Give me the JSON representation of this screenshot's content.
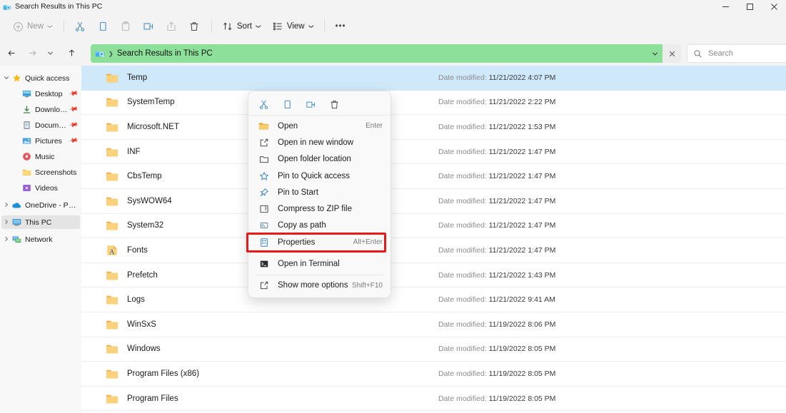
{
  "window": {
    "title": "Search Results in This PC",
    "icon": "explorer-search-icon",
    "minimize": "—",
    "maximize": "❐",
    "close": "✕"
  },
  "toolbar": {
    "new_label": "New",
    "new_icon": "plus-circle-icon",
    "cut_icon": "scissors-icon",
    "copy_icon": "copy-icon",
    "paste_icon": "paste-icon",
    "rename_icon": "rename-icon",
    "share_icon": "share-icon",
    "delete_icon": "trash-icon",
    "sort_label": "Sort",
    "sort_icon": "sort-arrows-icon",
    "view_label": "View",
    "view_icon": "view-list-icon",
    "more_label": "•••",
    "caret": "❯"
  },
  "navigation": {
    "back": "←",
    "forward": "→",
    "recent": "❯",
    "up": "↑"
  },
  "address": {
    "icon": "explorer-search-icon",
    "separator": "❯",
    "path": "Search Results in This PC",
    "dropdown": "❯",
    "clear": "✕",
    "highlight_color": "#8ce09a"
  },
  "search": {
    "placeholder": "Search",
    "value": "",
    "icon": "magnifier-icon"
  },
  "sidebar": {
    "items": [
      {
        "label": "Quick access",
        "icon": "star-icon",
        "chevron": "❯",
        "expanded": true,
        "indent": false,
        "pinned": false,
        "selected": false
      },
      {
        "label": "Desktop",
        "icon": "desktop-icon",
        "chevron": "",
        "expanded": false,
        "indent": true,
        "pinned": true,
        "selected": false
      },
      {
        "label": "Downloads",
        "icon": "downloads-icon",
        "chevron": "",
        "expanded": false,
        "indent": true,
        "pinned": true,
        "selected": false
      },
      {
        "label": "Documents",
        "icon": "documents-icon",
        "chevron": "",
        "expanded": false,
        "indent": true,
        "pinned": true,
        "selected": false
      },
      {
        "label": "Pictures",
        "icon": "pictures-icon",
        "chevron": "",
        "expanded": false,
        "indent": true,
        "pinned": true,
        "selected": false
      },
      {
        "label": "Music",
        "icon": "music-icon",
        "chevron": "",
        "expanded": false,
        "indent": true,
        "pinned": false,
        "selected": false
      },
      {
        "label": "Screenshots",
        "icon": "folder-icon",
        "chevron": "",
        "expanded": false,
        "indent": true,
        "pinned": false,
        "selected": false
      },
      {
        "label": "Videos",
        "icon": "videos-icon",
        "chevron": "",
        "expanded": false,
        "indent": true,
        "pinned": false,
        "selected": false
      },
      {
        "label": "OneDrive - Personal",
        "icon": "onedrive-cloud-icon",
        "chevron": "❯",
        "expanded": false,
        "indent": false,
        "pinned": false,
        "selected": false
      },
      {
        "label": "This PC",
        "icon": "this-pc-icon",
        "chevron": "❯",
        "expanded": false,
        "indent": false,
        "pinned": false,
        "selected": true
      },
      {
        "label": "Network",
        "icon": "network-icon",
        "chevron": "❯",
        "expanded": false,
        "indent": false,
        "pinned": false,
        "selected": false
      }
    ]
  },
  "filelist": {
    "date_label": "Date modified:",
    "rows": [
      {
        "name": "Temp",
        "icon": "folder-icon",
        "date": "11/21/2022 4:07 PM",
        "selected": true
      },
      {
        "name": "SystemTemp",
        "icon": "folder-icon",
        "date": "11/21/2022 2:22 PM",
        "selected": false
      },
      {
        "name": "Microsoft.NET",
        "icon": "folder-icon",
        "date": "11/21/2022 1:53 PM",
        "selected": false
      },
      {
        "name": "INF",
        "icon": "folder-icon",
        "date": "11/21/2022 1:47 PM",
        "selected": false
      },
      {
        "name": "CbsTemp",
        "icon": "folder-icon",
        "date": "11/21/2022 1:47 PM",
        "selected": false
      },
      {
        "name": "SysWOW64",
        "icon": "folder-icon",
        "date": "11/21/2022 1:47 PM",
        "selected": false
      },
      {
        "name": "System32",
        "icon": "folder-icon",
        "date": "11/21/2022 1:47 PM",
        "selected": false
      },
      {
        "name": "Fonts",
        "icon": "fonts-folder-icon",
        "date": "11/21/2022 1:47 PM",
        "selected": false
      },
      {
        "name": "Prefetch",
        "icon": "folder-icon",
        "date": "11/21/2022 1:43 PM",
        "selected": false
      },
      {
        "name": "Logs",
        "icon": "folder-icon",
        "date": "11/21/2022 9:41 AM",
        "selected": false
      },
      {
        "name": "WinSxS",
        "icon": "folder-icon",
        "date": "11/19/2022 8:06 PM",
        "selected": false
      },
      {
        "name": "Windows",
        "icon": "folder-icon",
        "date": "11/19/2022 8:05 PM",
        "selected": false
      },
      {
        "name": "Program Files (x86)",
        "icon": "folder-icon",
        "date": "11/19/2022 8:05 PM",
        "selected": false
      },
      {
        "name": "Program Files",
        "icon": "folder-icon",
        "date": "11/19/2022 8:05 PM",
        "selected": false
      }
    ]
  },
  "context_menu": {
    "icon_buttons": [
      {
        "name": "cut-icon",
        "tooltip": "Cut"
      },
      {
        "name": "copy-icon",
        "tooltip": "Copy"
      },
      {
        "name": "rename-icon",
        "tooltip": "Rename"
      },
      {
        "name": "delete-icon",
        "tooltip": "Delete"
      }
    ],
    "items": [
      {
        "label": "Open",
        "icon": "folder-open-icon",
        "accel": "Enter",
        "divider_after": false,
        "highlighted": false
      },
      {
        "label": "Open in new window",
        "icon": "new-window-icon",
        "accel": "",
        "divider_after": false,
        "highlighted": false
      },
      {
        "label": "Open folder location",
        "icon": "folder-outline-icon",
        "accel": "",
        "divider_after": false,
        "highlighted": false
      },
      {
        "label": "Pin to Quick access",
        "icon": "star-outline-icon",
        "accel": "",
        "divider_after": false,
        "highlighted": false
      },
      {
        "label": "Pin to Start",
        "icon": "pin-icon",
        "accel": "",
        "divider_after": false,
        "highlighted": false
      },
      {
        "label": "Compress to ZIP file",
        "icon": "zip-icon",
        "accel": "",
        "divider_after": false,
        "highlighted": false
      },
      {
        "label": "Copy as path",
        "icon": "copy-path-icon",
        "accel": "",
        "divider_after": false,
        "highlighted": false
      },
      {
        "label": "Properties",
        "icon": "properties-icon",
        "accel": "Alt+Enter",
        "divider_after": true,
        "highlighted": true
      },
      {
        "label": "Open in Terminal",
        "icon": "terminal-icon",
        "accel": "",
        "divider_after": true,
        "highlighted": false
      },
      {
        "label": "Show more options",
        "icon": "more-options-icon",
        "accel": "Shift+F10",
        "divider_after": false,
        "highlighted": false
      }
    ],
    "highlight_color": "#e81919"
  }
}
